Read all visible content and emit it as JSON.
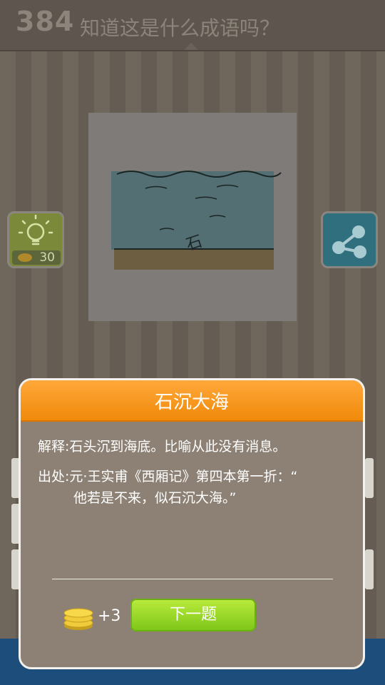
{
  "header": {
    "level": "384",
    "question": "知道这是什么成语吗？"
  },
  "hint": {
    "cost": "30",
    "icon": "lightbulb-icon"
  },
  "share": {
    "icon": "share-icon"
  },
  "puzzle": {
    "drawing_text": "石"
  },
  "dialog": {
    "title": "石沉大海",
    "meaning": "解释:石头沉到海底。比喻从此没有消息。",
    "source_prefix": "出处:元·王实甫《西厢记》第四本第一折：“",
    "source_quote": "他若是不来，似石沉大海。”",
    "reward": "+3",
    "next_label": "下一题"
  },
  "colors": {
    "header_orange": "#f59a1e",
    "next_green": "#8fd624",
    "dialog_bg": "#8c8174"
  }
}
